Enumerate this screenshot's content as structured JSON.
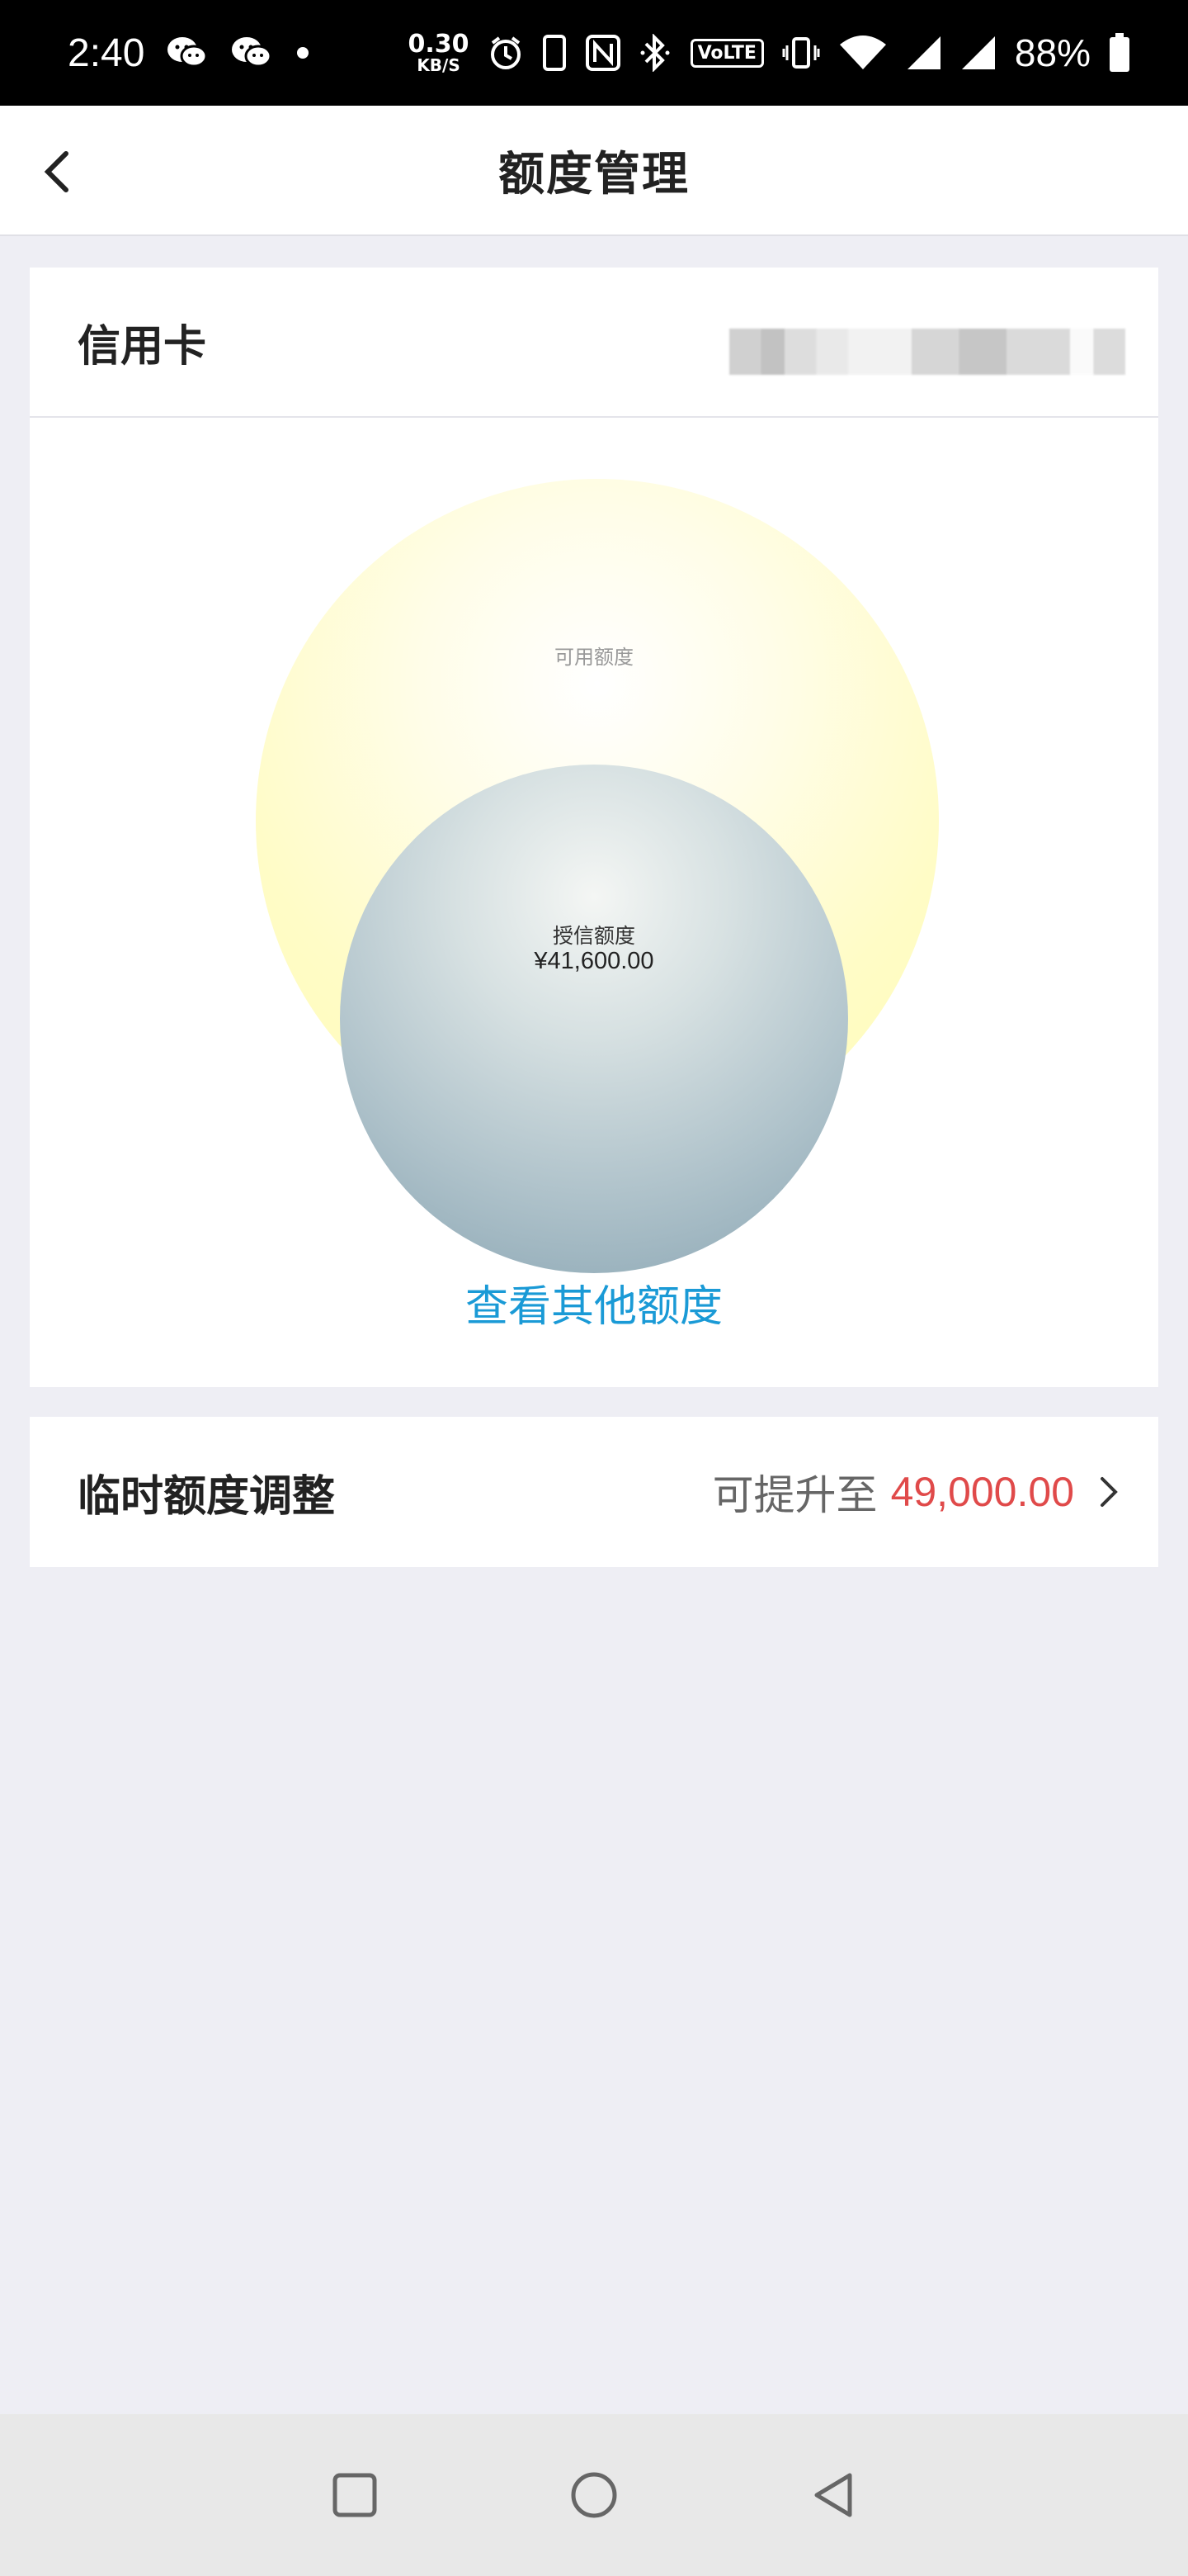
{
  "status_bar": {
    "time": "2:40",
    "net_speed_value": "0.30",
    "net_speed_unit": "KB/S",
    "volte": "VoLTE",
    "battery": "88%",
    "icons": [
      "wechat-icon",
      "wechat-icon",
      "dot-icon",
      "alarm-icon",
      "phone-icon",
      "nfc-icon",
      "bluetooth-icon",
      "volte-icon",
      "vibrate-icon",
      "wifi-icon",
      "signal-icon",
      "signal-icon",
      "battery-icon"
    ]
  },
  "header": {
    "title": "额度管理",
    "back_icon": "chevron-left-icon"
  },
  "card": {
    "type": "信用卡",
    "number_masked": true,
    "outer_circle_label": "可用额度",
    "inner_circle_label": "授信额度",
    "inner_circle_value": "¥41,600.00",
    "view_other_link": "查看其他额度",
    "colors": {
      "outer_circle": "#fffcb6",
      "inner_circle": "#88a4b2",
      "link": "#1a9ad6"
    }
  },
  "temp_adjust": {
    "title": "临时额度调整",
    "prefix": "可提升至",
    "amount": "49,000.00",
    "amount_color": "#e04a4a",
    "chevron_icon": "chevron-right-icon"
  },
  "nav_bar": {
    "buttons": [
      "recents-square-icon",
      "home-circle-icon",
      "back-triangle-icon"
    ]
  }
}
